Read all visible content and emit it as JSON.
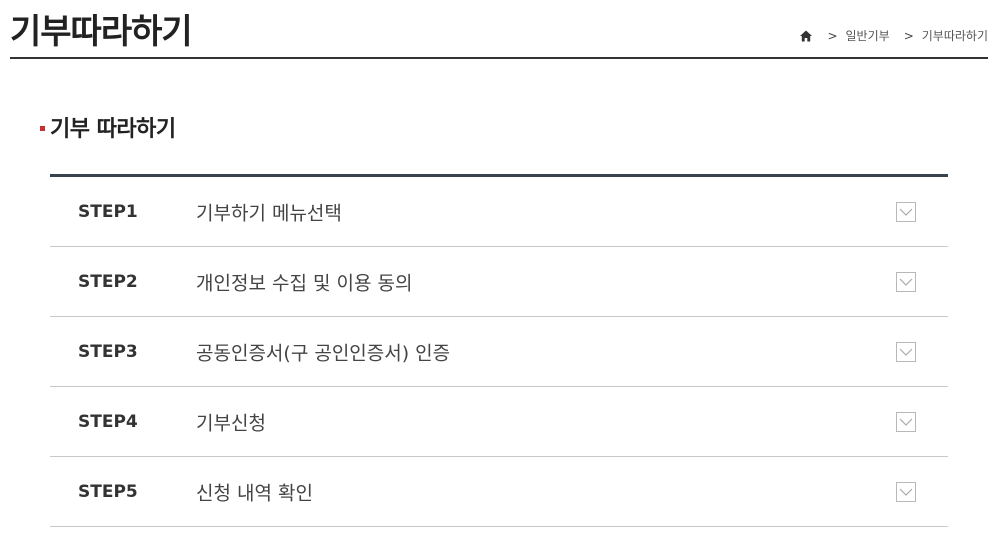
{
  "header": {
    "title": "기부따라하기",
    "breadcrumb": {
      "home_icon": "home-icon",
      "separator": ">",
      "items": [
        "일반기부",
        "기부따라하기"
      ]
    }
  },
  "section": {
    "title": "기부 따라하기",
    "bullet_color": "#c8302f"
  },
  "steps": [
    {
      "label": "STEP1",
      "title": "기부하기 메뉴선택",
      "icon": "chevron-down-icon"
    },
    {
      "label": "STEP2",
      "title": "개인정보 수집 및 이용 동의",
      "icon": "chevron-down-icon"
    },
    {
      "label": "STEP3",
      "title": "공동인증서(구 공인인증서) 인증",
      "icon": "chevron-down-icon"
    },
    {
      "label": "STEP4",
      "title": "기부신청",
      "icon": "chevron-down-icon"
    },
    {
      "label": "STEP5",
      "title": "신청 내역 확인",
      "icon": "chevron-down-icon"
    }
  ],
  "colors": {
    "accent_border": "#37434f",
    "row_divider": "#c8c8c8"
  }
}
